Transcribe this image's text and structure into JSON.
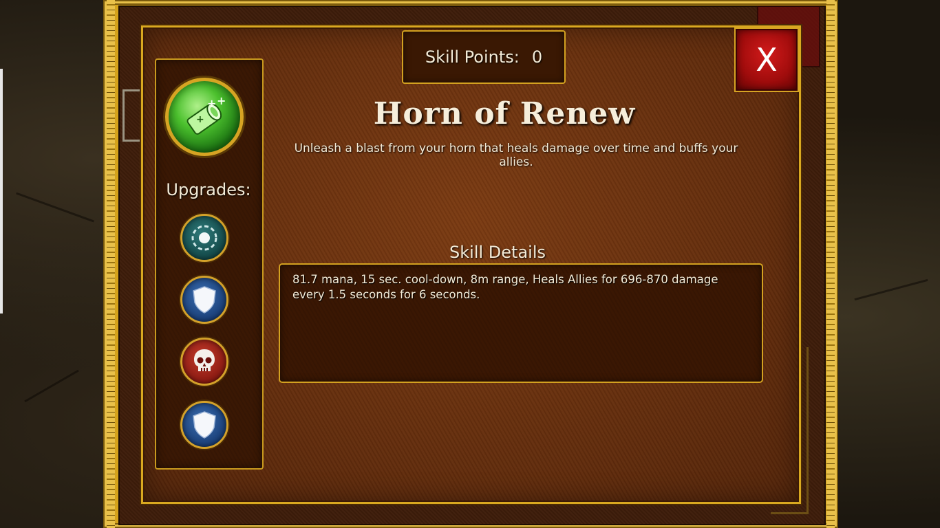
{
  "header": {
    "skill_points_label": "Skill Points:",
    "skill_points_value": "0",
    "close_label": "X"
  },
  "skill": {
    "icon": "horn-heal-icon",
    "title": "Horn of Renew",
    "description": "Unleash a blast from your horn that heals damage over time and buffs your allies."
  },
  "sidebar": {
    "upgrades_label": "Upgrades:",
    "upgrades": [
      {
        "icon": "ring-icon",
        "color": "#1f6565"
      },
      {
        "icon": "shield-icon",
        "color": "#1f4f8f"
      },
      {
        "icon": "skull-icon",
        "color": "#a01c12"
      },
      {
        "icon": "shield-icon",
        "color": "#1f4f8f"
      }
    ]
  },
  "details": {
    "label": "Skill Details",
    "text": "81.7 mana, 15 sec. cool-down, 8m range, Heals Allies for 696-870 damage every 1.5 seconds for 6 seconds."
  },
  "colors": {
    "gold_border": "#d9a820",
    "panel_brown": "#6a300e",
    "close_red": "#c0140f"
  }
}
